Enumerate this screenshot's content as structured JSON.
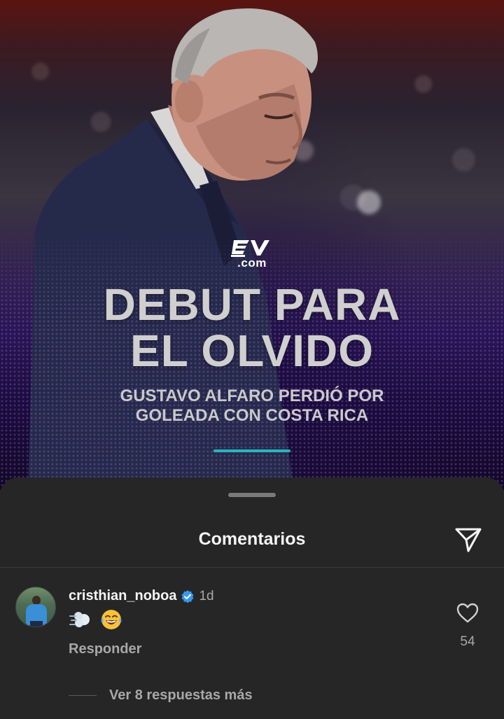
{
  "post": {
    "logo_text": ".com",
    "headline_line1": "DEBUT PARA",
    "headline_line2": "EL OLVIDO",
    "subheadline_line1": "GUSTAVO ALFARO PERDIÓ POR",
    "subheadline_line2": "GOLEADA CON COSTA RICA",
    "accent_color": "#2ab3c0"
  },
  "sheet": {
    "title": "Comentarios",
    "share_icon": "paper-plane-icon"
  },
  "comment": {
    "username": "cristhian_noboa",
    "verified": true,
    "time": "1d",
    "emojis": [
      "dash-emoji",
      "tears-of-joy-emoji"
    ],
    "reply_label": "Responder",
    "like_icon": "heart-outline-icon",
    "like_count": "54",
    "view_replies_label": "Ver 8 respuestas más"
  },
  "colors": {
    "sheet_background": "#262626",
    "text_primary": "#f5f5f5",
    "text_secondary": "#a8a8a8",
    "verified_badge": "#3897f0"
  }
}
